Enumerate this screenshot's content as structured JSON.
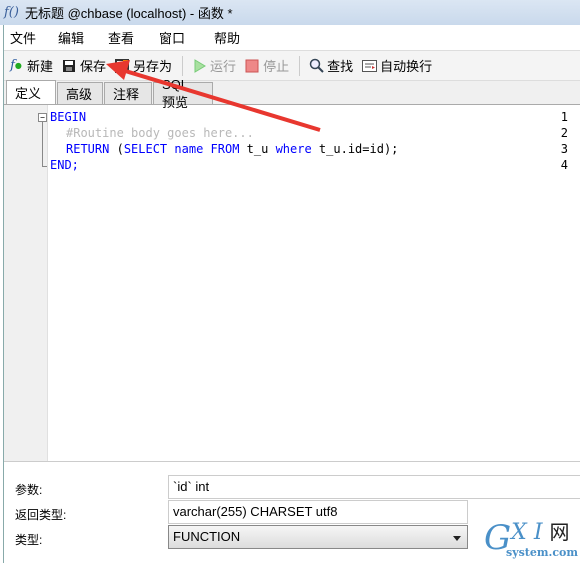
{
  "window": {
    "title": "无标题 @chbase (localhost) - 函数 *"
  },
  "menu": [
    "文件",
    "编辑",
    "查看",
    "窗口",
    "帮助"
  ],
  "toolbar": {
    "new": "新建",
    "save": "保存",
    "save_as": "另存为",
    "run": "运行",
    "stop": "停止",
    "find": "查找",
    "word_wrap": "自动换行"
  },
  "tabs": [
    "定义",
    "高级",
    "注释",
    "SQL 预览"
  ],
  "editor": {
    "line_numbers": [
      "1",
      "2",
      "3",
      "4"
    ],
    "lines": {
      "l1": "BEGIN",
      "l2": "#Routine body goes here...",
      "l3a": "RETURN",
      "l3b": " (",
      "l3c": "SELECT",
      "l3d": " ",
      "l3e": "name",
      "l3f": " ",
      "l3g": "FROM",
      "l3h": " t_u ",
      "l3i": "where",
      "l3j": " t_u.id=id);",
      "l4": "END;"
    },
    "keyword_color": "#0000ff",
    "comment_color": "#b8b8b8"
  },
  "form": {
    "params_label": "参数:",
    "params_value": "`id` int",
    "return_label": "返回类型:",
    "return_value": "varchar(255) CHARSET utf8",
    "type_label": "类型:",
    "type_value": "FUNCTION"
  },
  "watermark": "GXI网 system.com",
  "annotation": {
    "arrow_color": "#e8372f",
    "points_to": "save-button"
  }
}
